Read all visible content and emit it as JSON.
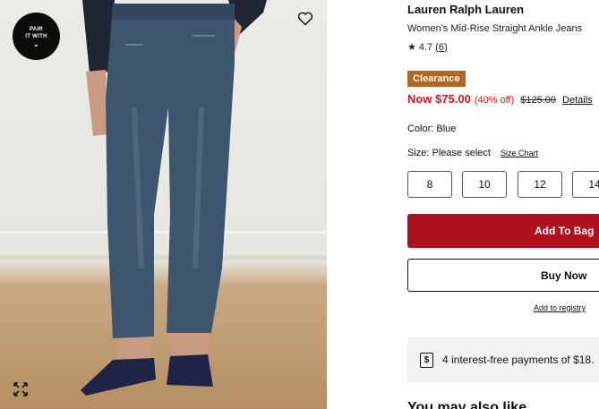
{
  "product_image": {
    "pair_badge": {
      "line1": "PAIR",
      "line2": "IT WITH"
    },
    "wishlist_icon": "heart-outline-icon",
    "expand_icon": "expand-arrows-icon"
  },
  "product": {
    "brand": "Lauren Ralph Lauren",
    "name": "Women's Mid-Rise Straight Ankle Jeans",
    "rating": "4.7",
    "review_count": "(6)",
    "badge": "Clearance",
    "price_now": "Now $75.00",
    "discount": "(40% off)",
    "price_original": "$125.00",
    "details_link": "Details",
    "color_label": "Color: Blue",
    "size_label": "Size: Please select",
    "size_chart_link": "Size Chart",
    "sizes": [
      "8",
      "10",
      "12",
      "14"
    ]
  },
  "actions": {
    "add_to_bag": "Add To Bag",
    "buy_now": "Buy Now",
    "registry_link": "Add to registry"
  },
  "payments": {
    "text": "4 interest-free payments of $18."
  },
  "peek_heading": "You may also like",
  "colors": {
    "brand_red": "#b0111d",
    "sale_red": "#d1182b",
    "clearance_bg": "#b5651d",
    "denim": "#3d5670"
  }
}
